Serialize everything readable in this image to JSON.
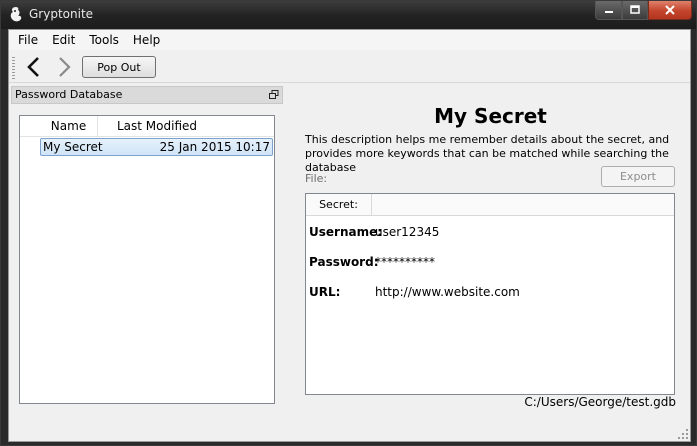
{
  "window": {
    "title": "Gryptonite"
  },
  "menu": {
    "items": [
      "File",
      "Edit",
      "Tools",
      "Help"
    ]
  },
  "toolbar": {
    "popout_label": "Pop Out",
    "back_icon": "chevron-left-icon",
    "forward_icon": "chevron-right-icon"
  },
  "database_panel": {
    "title": "Password Database",
    "columns": [
      "Name",
      "Last Modified"
    ],
    "rows": [
      {
        "name": "My Secret",
        "last_modified": "25 Jan 2015 10:17"
      }
    ]
  },
  "secret": {
    "title": "My Secret",
    "description": "This description helps me remember details about the secret, and provides more keywords that can be matched while searching the database",
    "file_label": "File:",
    "export_label": "Export",
    "tab_label": "Secret:",
    "fields": [
      {
        "label": "Username:",
        "value": "user12345"
      },
      {
        "label": "Password:",
        "value": "**********"
      },
      {
        "label": "URL:",
        "value": "http://www.website.com"
      }
    ]
  },
  "status": {
    "path": "C:/Users/George/test.gdb"
  },
  "colors": {
    "selection": "#cfe4f7",
    "selection_border": "#7da2ce",
    "close_button": "#c4442b"
  }
}
